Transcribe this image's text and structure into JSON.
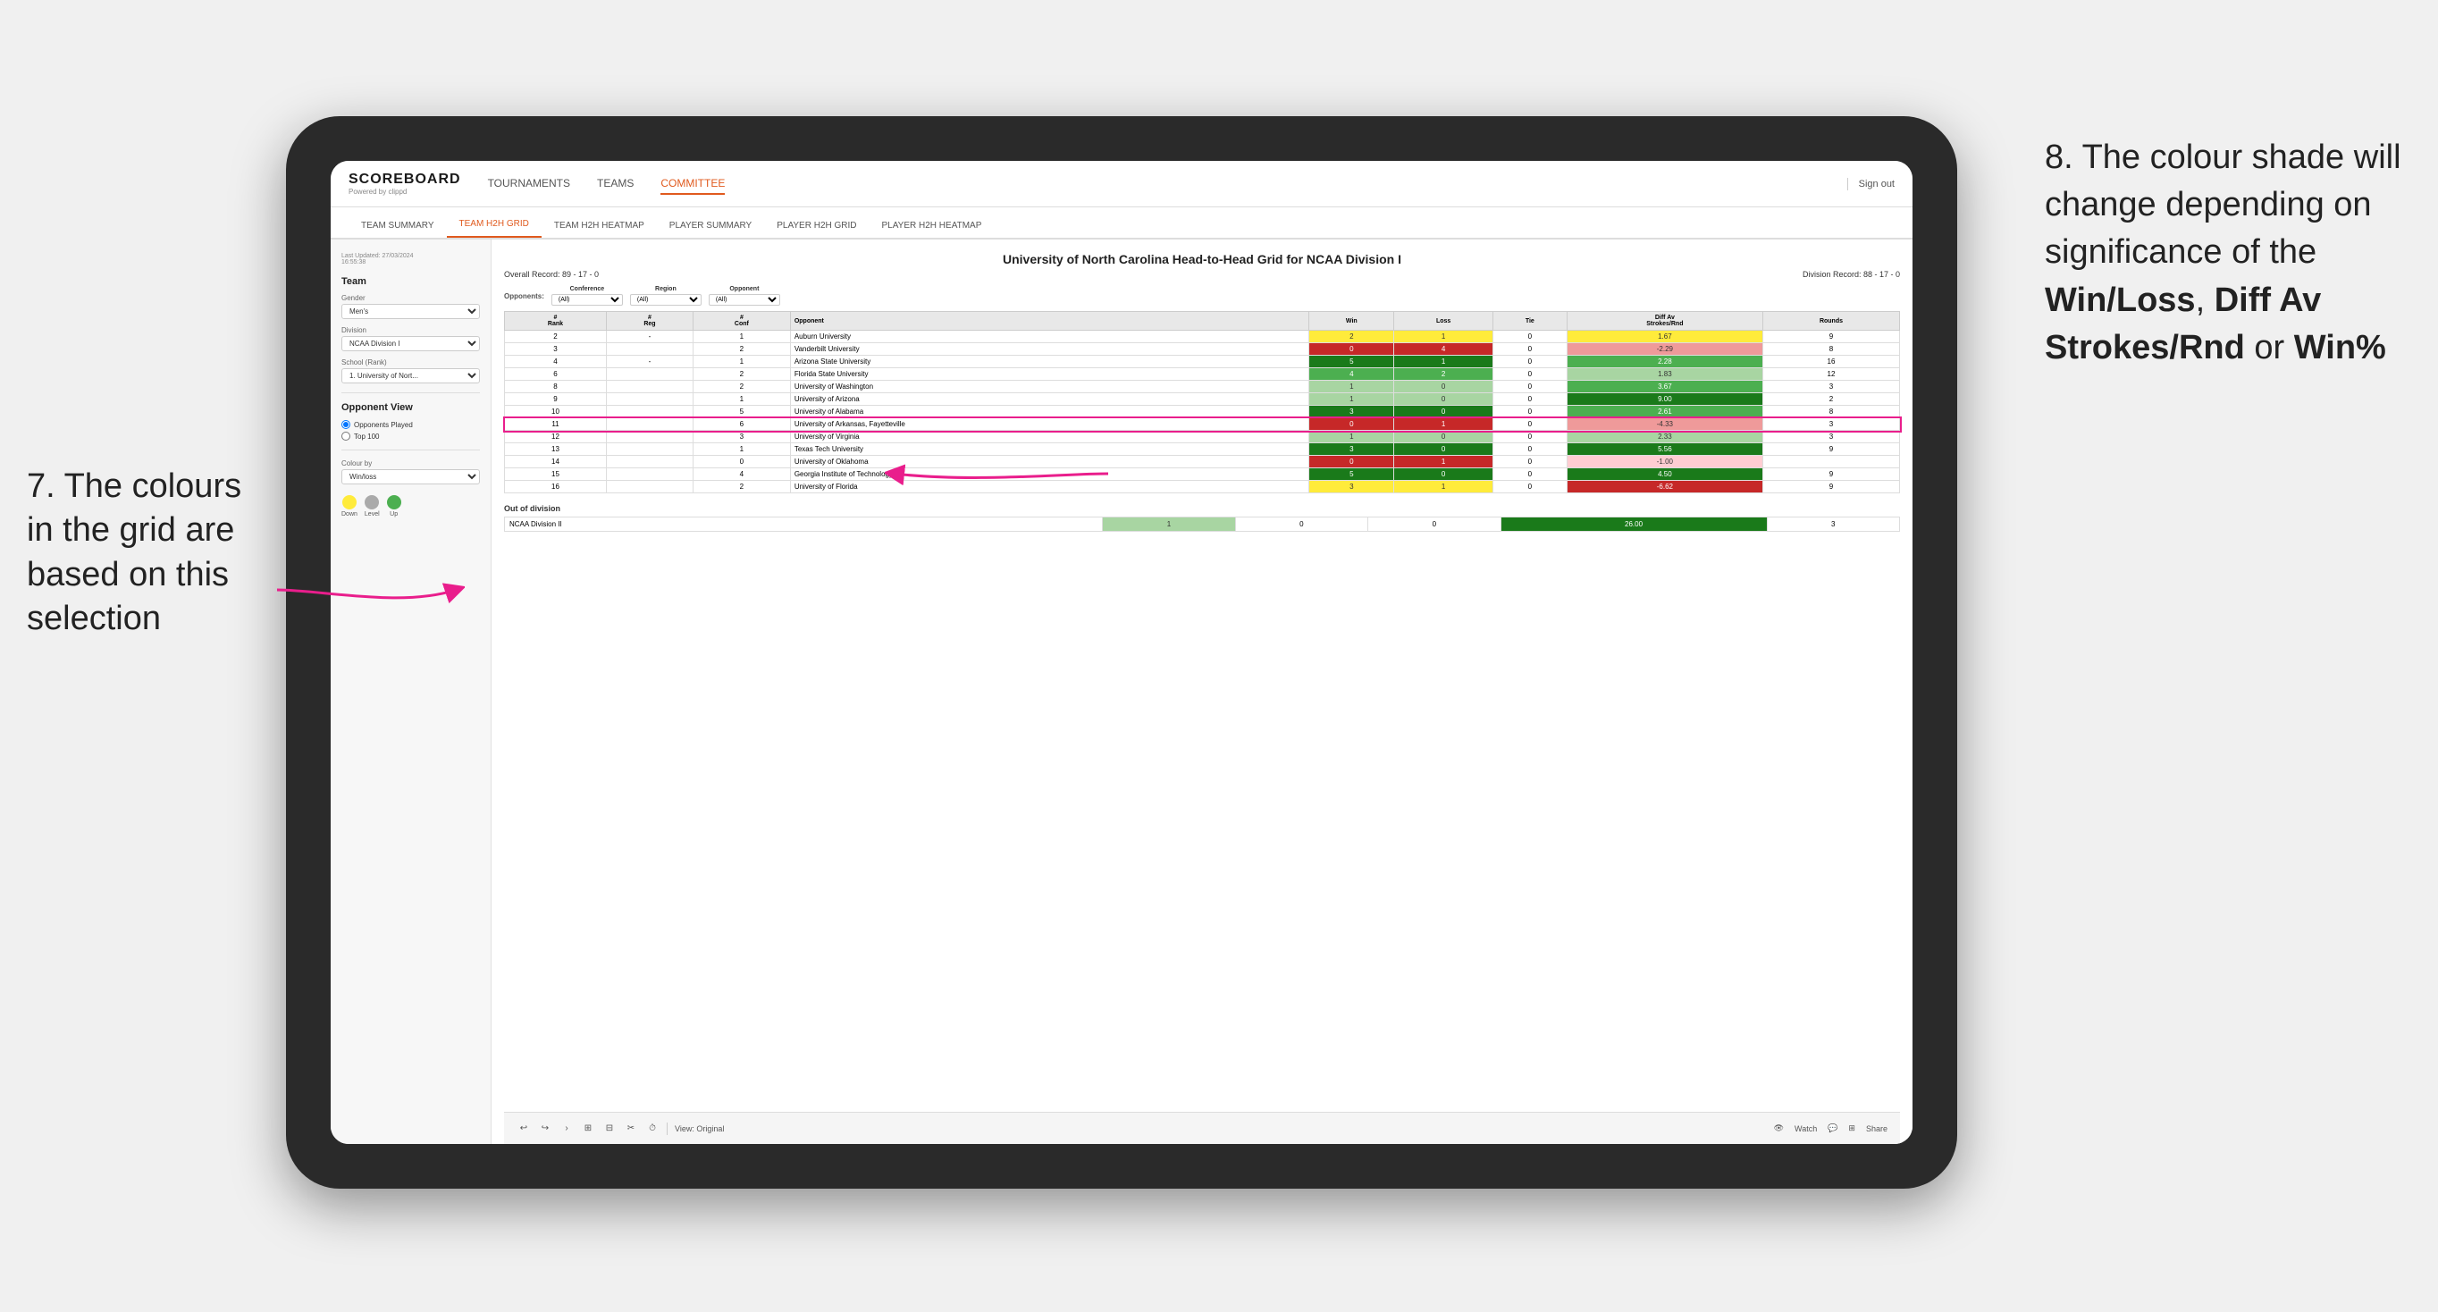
{
  "annotations": {
    "left_text": "7. The colours in the grid are based on this selection",
    "right_text_1": "8. The colour shade will change depending on significance of the",
    "right_bold_1": "Win/Loss",
    "right_bold_2": "Diff Av Strokes/Rnd",
    "right_bold_3": "Win%",
    "right_connector": " or"
  },
  "header": {
    "logo": "SCOREBOARD",
    "logo_sub": "Powered by clippd",
    "nav": [
      "TOURNAMENTS",
      "TEAMS",
      "COMMITTEE"
    ],
    "sign_out": "Sign out"
  },
  "sub_nav": {
    "items": [
      "TEAM SUMMARY",
      "TEAM H2H GRID",
      "TEAM H2H HEATMAP",
      "PLAYER SUMMARY",
      "PLAYER H2H GRID",
      "PLAYER H2H HEATMAP"
    ],
    "active": "TEAM H2H GRID"
  },
  "sidebar": {
    "timestamp": "Last Updated: 27/03/2024\n16:55:38",
    "section_title": "Team",
    "gender_label": "Gender",
    "gender_value": "Men's",
    "division_label": "Division",
    "division_value": "NCAA Division I",
    "school_label": "School (Rank)",
    "school_value": "1. University of Nort...",
    "opponent_view_label": "Opponent View",
    "radio_1": "Opponents Played",
    "radio_2": "Top 100",
    "colour_by_label": "Colour by",
    "colour_by_value": "Win/loss",
    "legend": [
      {
        "color": "#ffeb3b",
        "label": "Down"
      },
      {
        "color": "#aaaaaa",
        "label": "Level"
      },
      {
        "color": "#4caf50",
        "label": "Up"
      }
    ]
  },
  "grid": {
    "title": "University of North Carolina Head-to-Head Grid for NCAA Division I",
    "overall_record": "Overall Record: 89 - 17 - 0",
    "division_record": "Division Record: 88 - 17 - 0",
    "filters": {
      "opponents_label": "Opponents:",
      "conference_label": "Conference",
      "conference_value": "(All)",
      "region_label": "Region",
      "region_value": "(All)",
      "opponent_label": "Opponent",
      "opponent_value": "(All)"
    },
    "columns": [
      "#\nRank",
      "#\nReg",
      "#\nConf",
      "Opponent",
      "Win",
      "Loss",
      "Tie",
      "Diff Av\nStrokes/Rnd",
      "Rounds"
    ],
    "rows": [
      {
        "rank": "2",
        "reg": "-",
        "conf": "1",
        "opponent": "Auburn University",
        "win": 2,
        "loss": 1,
        "tie": 0,
        "diff": "1.67",
        "rounds": 9,
        "win_color": "yellow",
        "diff_color": "yellow"
      },
      {
        "rank": "3",
        "reg": "",
        "conf": "2",
        "opponent": "Vanderbilt University",
        "win": 0,
        "loss": 4,
        "tie": 0,
        "diff": "-2.29",
        "rounds": 8,
        "win_color": "red-dark",
        "diff_color": "red-mid"
      },
      {
        "rank": "4",
        "reg": "-",
        "conf": "1",
        "opponent": "Arizona State University",
        "win": 5,
        "loss": 1,
        "tie": 0,
        "diff": "2.28",
        "rounds": 16,
        "win_color": "green-dark",
        "diff_color": "green-mid"
      },
      {
        "rank": "6",
        "reg": "",
        "conf": "2",
        "opponent": "Florida State University",
        "win": 4,
        "loss": 2,
        "tie": 0,
        "diff": "1.83",
        "rounds": 12,
        "win_color": "green-mid",
        "diff_color": "green-light"
      },
      {
        "rank": "8",
        "reg": "",
        "conf": "2",
        "opponent": "University of Washington",
        "win": 1,
        "loss": 0,
        "tie": 0,
        "diff": "3.67",
        "rounds": 3,
        "win_color": "green-light",
        "diff_color": "green-mid"
      },
      {
        "rank": "9",
        "reg": "",
        "conf": "1",
        "opponent": "University of Arizona",
        "win": 1,
        "loss": 0,
        "tie": 0,
        "diff": "9.00",
        "rounds": 2,
        "win_color": "green-light",
        "diff_color": "green-dark"
      },
      {
        "rank": "10",
        "reg": "",
        "conf": "5",
        "opponent": "University of Alabama",
        "win": 3,
        "loss": 0,
        "tie": 0,
        "diff": "2.61",
        "rounds": 8,
        "win_color": "green-dark",
        "diff_color": "green-mid"
      },
      {
        "rank": "11",
        "reg": "",
        "conf": "6",
        "opponent": "University of Arkansas, Fayetteville",
        "win": 0,
        "loss": 1,
        "tie": 0,
        "diff": "-4.33",
        "rounds": 3,
        "win_color": "red-dark",
        "diff_color": "red-mid",
        "highlight": true
      },
      {
        "rank": "12",
        "reg": "",
        "conf": "3",
        "opponent": "University of Virginia",
        "win": 1,
        "loss": 0,
        "tie": 0,
        "diff": "2.33",
        "rounds": 3,
        "win_color": "green-light",
        "diff_color": "green-light"
      },
      {
        "rank": "13",
        "reg": "",
        "conf": "1",
        "opponent": "Texas Tech University",
        "win": 3,
        "loss": 0,
        "tie": 0,
        "diff": "5.56",
        "rounds": 9,
        "win_color": "green-dark",
        "diff_color": "green-dark"
      },
      {
        "rank": "14",
        "reg": "",
        "conf": "0",
        "opponent": "University of Oklahoma",
        "win": 0,
        "loss": 1,
        "tie": 0,
        "diff": "-1.00",
        "rounds": "",
        "win_color": "red-dark",
        "diff_color": "red-light"
      },
      {
        "rank": "15",
        "reg": "",
        "conf": "4",
        "opponent": "Georgia Institute of Technology",
        "win": 5,
        "loss": 0,
        "tie": 0,
        "diff": "4.50",
        "rounds": 9,
        "win_color": "green-dark",
        "diff_color": "green-dark"
      },
      {
        "rank": "16",
        "reg": "",
        "conf": "2",
        "opponent": "University of Florida",
        "win": 3,
        "loss": 1,
        "tie": 0,
        "diff": "-6.62",
        "rounds": 9,
        "win_color": "yellow",
        "diff_color": "red-dark"
      }
    ],
    "out_of_division_label": "Out of division",
    "out_of_division_row": {
      "division": "NCAA Division II",
      "win": 1,
      "loss": 0,
      "tie": 0,
      "diff": "26.00",
      "rounds": 3,
      "win_color": "green-light",
      "diff_color": "green-dark"
    }
  },
  "toolbar": {
    "view_label": "View: Original",
    "watch_label": "Watch",
    "share_label": "Share"
  }
}
